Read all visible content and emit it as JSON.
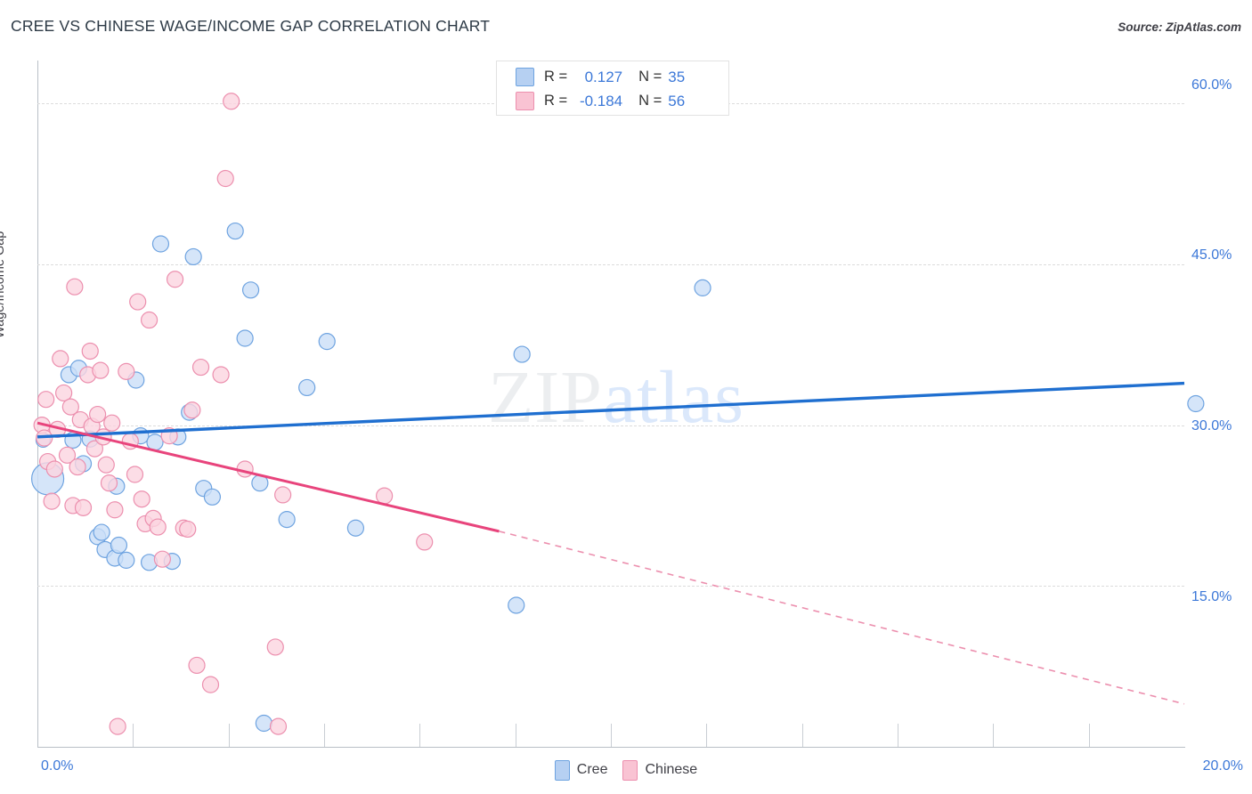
{
  "header": {
    "title": "CREE VS CHINESE WAGE/INCOME GAP CORRELATION CHART",
    "source": "Source: ZipAtlas.com"
  },
  "watermark": {
    "part1": "ZIP",
    "part2": "atlas"
  },
  "stat_legend": {
    "rows": [
      {
        "series": "Cree",
        "swatch": "blue",
        "r_label": "R =",
        "r_value": "0.127",
        "n_label": "N =",
        "n_value": "35"
      },
      {
        "series": "Chinese",
        "swatch": "pink",
        "r_label": "R =",
        "r_value": "-0.184",
        "n_label": "N =",
        "n_value": "56"
      }
    ]
  },
  "series_legend": [
    {
      "label": "Cree",
      "color": "#b6d0f2"
    },
    {
      "label": "Chinese",
      "color": "#f9c3d3"
    }
  ],
  "axes": {
    "y_title": "Wage/Income Gap",
    "y_ticks": [
      "60.0%",
      "45.0%",
      "30.0%",
      "15.0%"
    ],
    "x_min_label": "0.0%",
    "x_max_label": "20.0%"
  },
  "chart_data": {
    "type": "scatter",
    "title": "CREE VS CHINESE WAGE/INCOME GAP CORRELATION CHART",
    "xlabel": "",
    "ylabel": "Wage/Income Gap",
    "xlim": [
      0.0,
      20.0
    ],
    "ylim": [
      0.0,
      64.0
    ],
    "x_tick_labels": [
      "0.0%",
      "20.0%"
    ],
    "y_tick_labels": [
      "15.0%",
      "30.0%",
      "45.0%",
      "60.0%"
    ],
    "y_tick_values": [
      15.0,
      30.0,
      45.0,
      60.0
    ],
    "grid": "horizontal-dashed",
    "legend_position": "bottom-center",
    "watermark": "ZIPatlas",
    "series": [
      {
        "name": "Cree",
        "color": "#cbdff7",
        "edge_color": "#6ea3e0",
        "R": 0.127,
        "N": 35,
        "trend": {
          "x0": 0.0,
          "y0": 28.9,
          "x1": 20.0,
          "y1": 33.9,
          "style": "solid",
          "color": "#1f6fd0"
        },
        "points": [
          {
            "x": 0.1,
            "y": 28.6,
            "r": 8
          },
          {
            "x": 0.18,
            "y": 25.0,
            "r": 18
          },
          {
            "x": 0.55,
            "y": 34.7,
            "r": 9
          },
          {
            "x": 0.62,
            "y": 28.6,
            "r": 9
          },
          {
            "x": 0.72,
            "y": 35.3,
            "r": 9
          },
          {
            "x": 0.8,
            "y": 26.4,
            "r": 9
          },
          {
            "x": 0.92,
            "y": 28.7,
            "r": 9
          },
          {
            "x": 1.05,
            "y": 19.6,
            "r": 9
          },
          {
            "x": 1.12,
            "y": 20.0,
            "r": 9
          },
          {
            "x": 1.18,
            "y": 18.4,
            "r": 9
          },
          {
            "x": 1.35,
            "y": 17.6,
            "r": 9
          },
          {
            "x": 1.38,
            "y": 24.3,
            "r": 9
          },
          {
            "x": 1.42,
            "y": 18.8,
            "r": 9
          },
          {
            "x": 1.55,
            "y": 17.4,
            "r": 9
          },
          {
            "x": 1.72,
            "y": 34.2,
            "r": 9
          },
          {
            "x": 1.8,
            "y": 29.0,
            "r": 9
          },
          {
            "x": 1.95,
            "y": 17.2,
            "r": 9
          },
          {
            "x": 2.05,
            "y": 28.4,
            "r": 9
          },
          {
            "x": 2.15,
            "y": 46.9,
            "r": 9
          },
          {
            "x": 2.35,
            "y": 17.3,
            "r": 9
          },
          {
            "x": 2.45,
            "y": 28.9,
            "r": 9
          },
          {
            "x": 2.65,
            "y": 31.2,
            "r": 9
          },
          {
            "x": 2.72,
            "y": 45.7,
            "r": 9
          },
          {
            "x": 2.9,
            "y": 24.1,
            "r": 9
          },
          {
            "x": 3.05,
            "y": 23.3,
            "r": 9
          },
          {
            "x": 3.45,
            "y": 48.1,
            "r": 9
          },
          {
            "x": 3.62,
            "y": 38.1,
            "r": 9
          },
          {
            "x": 3.72,
            "y": 42.6,
            "r": 9
          },
          {
            "x": 3.88,
            "y": 24.6,
            "r": 9
          },
          {
            "x": 3.95,
            "y": 2.2,
            "r": 9
          },
          {
            "x": 4.35,
            "y": 21.2,
            "r": 9
          },
          {
            "x": 4.7,
            "y": 33.5,
            "r": 9
          },
          {
            "x": 5.05,
            "y": 37.8,
            "r": 9
          },
          {
            "x": 5.55,
            "y": 20.4,
            "r": 9
          },
          {
            "x": 8.35,
            "y": 13.2,
            "r": 9
          },
          {
            "x": 8.45,
            "y": 36.6,
            "r": 9
          },
          {
            "x": 11.6,
            "y": 42.8,
            "r": 9
          },
          {
            "x": 20.2,
            "y": 32.0,
            "r": 9
          }
        ]
      },
      {
        "name": "Chinese",
        "color": "#fbd5e0",
        "edge_color": "#ec8fae",
        "R": -0.184,
        "N": 56,
        "trend": {
          "x0": 0.0,
          "y0": 30.2,
          "x1": 8.05,
          "y1": 20.1,
          "style": "solid-then-dashed",
          "dash_from_x": 8.05,
          "dash_to_x": 20.0,
          "dash_to_y": 4.0,
          "color": "#e8447c"
        },
        "points": [
          {
            "x": 0.08,
            "y": 30.0,
            "r": 9
          },
          {
            "x": 0.12,
            "y": 28.8,
            "r": 9
          },
          {
            "x": 0.15,
            "y": 32.4,
            "r": 9
          },
          {
            "x": 0.18,
            "y": 26.6,
            "r": 9
          },
          {
            "x": 0.25,
            "y": 22.9,
            "r": 9
          },
          {
            "x": 0.3,
            "y": 25.9,
            "r": 9
          },
          {
            "x": 0.35,
            "y": 29.6,
            "r": 9
          },
          {
            "x": 0.4,
            "y": 36.2,
            "r": 9
          },
          {
            "x": 0.46,
            "y": 33.0,
            "r": 9
          },
          {
            "x": 0.52,
            "y": 27.2,
            "r": 9
          },
          {
            "x": 0.58,
            "y": 31.7,
            "r": 9
          },
          {
            "x": 0.62,
            "y": 22.5,
            "r": 9
          },
          {
            "x": 0.65,
            "y": 42.9,
            "r": 9
          },
          {
            "x": 0.7,
            "y": 26.1,
            "r": 9
          },
          {
            "x": 0.75,
            "y": 30.5,
            "r": 9
          },
          {
            "x": 0.8,
            "y": 22.3,
            "r": 9
          },
          {
            "x": 0.88,
            "y": 34.7,
            "r": 9
          },
          {
            "x": 0.92,
            "y": 36.9,
            "r": 9
          },
          {
            "x": 0.95,
            "y": 29.9,
            "r": 9
          },
          {
            "x": 1.0,
            "y": 27.8,
            "r": 9
          },
          {
            "x": 1.05,
            "y": 31.0,
            "r": 9
          },
          {
            "x": 1.1,
            "y": 35.1,
            "r": 9
          },
          {
            "x": 1.15,
            "y": 28.9,
            "r": 9
          },
          {
            "x": 1.2,
            "y": 26.3,
            "r": 9
          },
          {
            "x": 1.25,
            "y": 24.6,
            "r": 9
          },
          {
            "x": 1.3,
            "y": 30.2,
            "r": 9
          },
          {
            "x": 1.35,
            "y": 22.1,
            "r": 9
          },
          {
            "x": 1.4,
            "y": 1.9,
            "r": 9
          },
          {
            "x": 1.55,
            "y": 35.0,
            "r": 9
          },
          {
            "x": 1.62,
            "y": 28.5,
            "r": 9
          },
          {
            "x": 1.7,
            "y": 25.4,
            "r": 9
          },
          {
            "x": 1.75,
            "y": 41.5,
            "r": 9
          },
          {
            "x": 1.82,
            "y": 23.1,
            "r": 9
          },
          {
            "x": 1.88,
            "y": 20.8,
            "r": 9
          },
          {
            "x": 1.95,
            "y": 39.8,
            "r": 9
          },
          {
            "x": 2.02,
            "y": 21.3,
            "r": 9
          },
          {
            "x": 2.1,
            "y": 20.5,
            "r": 9
          },
          {
            "x": 2.18,
            "y": 17.5,
            "r": 9
          },
          {
            "x": 2.3,
            "y": 29.0,
            "r": 9
          },
          {
            "x": 2.4,
            "y": 43.6,
            "r": 9
          },
          {
            "x": 2.55,
            "y": 20.4,
            "r": 9
          },
          {
            "x": 2.62,
            "y": 20.3,
            "r": 9
          },
          {
            "x": 2.7,
            "y": 31.4,
            "r": 9
          },
          {
            "x": 2.78,
            "y": 7.6,
            "r": 9
          },
          {
            "x": 2.85,
            "y": 35.4,
            "r": 9
          },
          {
            "x": 3.02,
            "y": 5.8,
            "r": 9
          },
          {
            "x": 3.2,
            "y": 34.7,
            "r": 9
          },
          {
            "x": 3.28,
            "y": 53.0,
            "r": 9
          },
          {
            "x": 3.38,
            "y": 60.2,
            "r": 9
          },
          {
            "x": 3.62,
            "y": 25.9,
            "r": 9
          },
          {
            "x": 4.15,
            "y": 9.3,
            "r": 9
          },
          {
            "x": 4.2,
            "y": 1.9,
            "r": 9
          },
          {
            "x": 4.28,
            "y": 23.5,
            "r": 9
          },
          {
            "x": 6.05,
            "y": 23.4,
            "r": 9
          },
          {
            "x": 6.75,
            "y": 19.1,
            "r": 9
          }
        ]
      }
    ]
  }
}
